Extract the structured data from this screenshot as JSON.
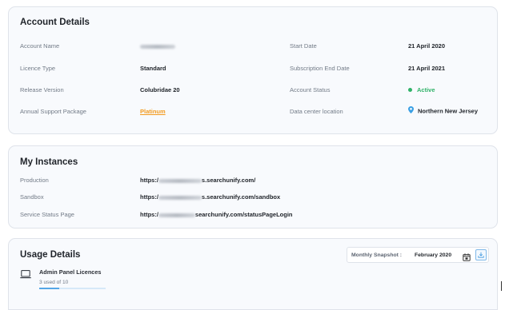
{
  "account_details": {
    "title": "Account Details",
    "left": [
      {
        "label": "Account Name",
        "value": ""
      },
      {
        "label": "Licence Type",
        "value": "Standard"
      },
      {
        "label": "Release Version",
        "value": "Colubridae 20"
      },
      {
        "label": "Annual Support Package",
        "value": "Platinum"
      }
    ],
    "right": [
      {
        "label": "Start Date",
        "value": "21 April 2020"
      },
      {
        "label": "Subscription End Date",
        "value": "21 April 2021"
      },
      {
        "label": "Account Status",
        "value": "Active"
      },
      {
        "label": "Data center location",
        "value": "Northern New Jersey"
      }
    ]
  },
  "my_instances": {
    "title": "My Instances",
    "rows": [
      {
        "label": "Production",
        "prefix": "https:/",
        "suffix": "s.searchunify.com/"
      },
      {
        "label": "Sandbox",
        "prefix": "https:/",
        "suffix": "s.searchunify.com/sandbox"
      },
      {
        "label": "Service Status Page",
        "prefix": "https:/",
        "suffix": "searchunify.com/statusPageLogin"
      }
    ]
  },
  "usage_details": {
    "title": "Usage Details",
    "snapshot_label": "Monthly Snapshot :",
    "snapshot_value": "February 2020",
    "licence_name": "Admin Panel Licences",
    "licence_used": "3 used of 10",
    "licence_fraction": 0.3
  },
  "colors": {
    "link": "#f39a1e",
    "active": "#2fb268",
    "accent": "#55a7e7"
  },
  "icons": [
    "location-pin-icon",
    "calendar-icon",
    "download-icon",
    "laptop-icon"
  ]
}
